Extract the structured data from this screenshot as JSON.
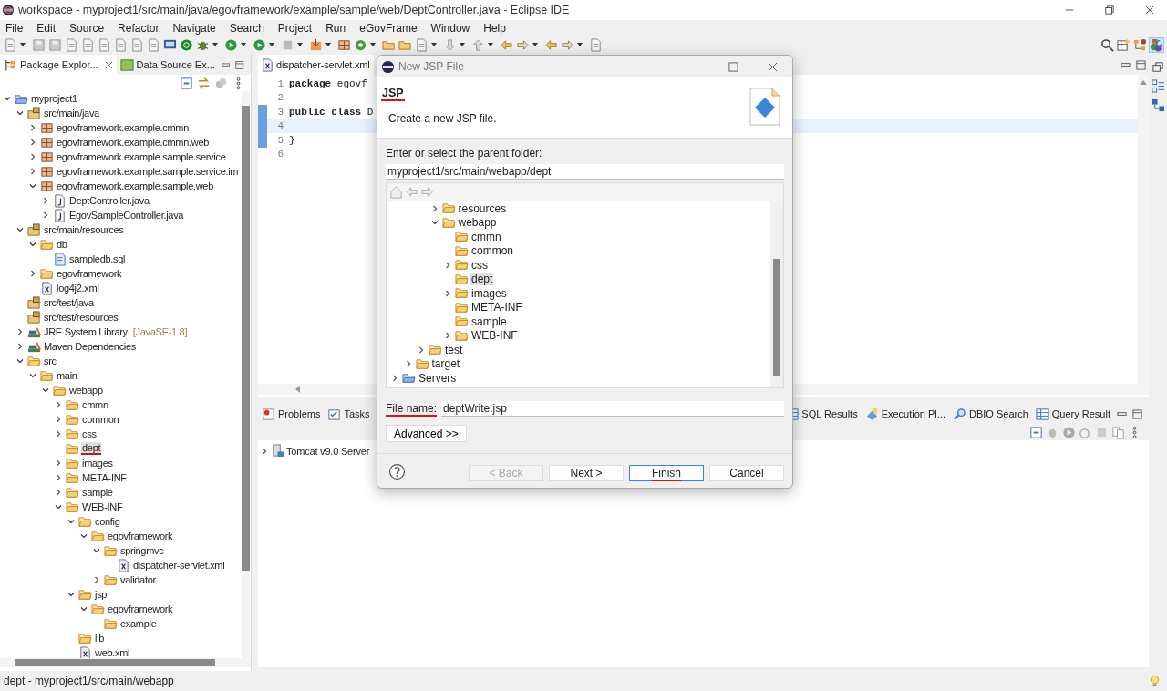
{
  "window": {
    "title": "workspace - myproject1/src/main/java/egovframework/example/sample/web/DeptController.java - Eclipse IDE"
  },
  "menu": [
    "File",
    "Edit",
    "Source",
    "Refactor",
    "Navigate",
    "Search",
    "Project",
    "Run",
    "eGovFrame",
    "Window",
    "Help"
  ],
  "left_panel": {
    "tabs": [
      {
        "label": "Package Explor...",
        "selected": true
      },
      {
        "label": "Data Source Ex...",
        "selected": false
      }
    ],
    "tree": [
      {
        "label": "myproject1",
        "kind": "project",
        "expanded": true,
        "selected": false,
        "children": [
          {
            "label": "src/main/java",
            "kind": "source-folder",
            "expanded": true,
            "selected": false,
            "children": [
              {
                "label": "egovframework.example.cmmn",
                "kind": "package",
                "expanded": false,
                "selected": false
              },
              {
                "label": "egovframework.example.cmmn.web",
                "kind": "package",
                "expanded": false,
                "selected": false
              },
              {
                "label": "egovframework.example.sample.service",
                "kind": "package",
                "expanded": false,
                "selected": false
              },
              {
                "label": "egovframework.example.sample.service.im",
                "kind": "package",
                "expanded": false,
                "selected": false
              },
              {
                "label": "egovframework.example.sample.web",
                "kind": "package",
                "expanded": true,
                "selected": false,
                "children": [
                  {
                    "label": "DeptController.java",
                    "kind": "java-file",
                    "expanded": false,
                    "selected": false
                  },
                  {
                    "label": "EgovSampleController.java",
                    "kind": "java-file",
                    "expanded": false,
                    "selected": false
                  }
                ]
              }
            ]
          },
          {
            "label": "src/main/resources",
            "kind": "source-folder",
            "expanded": true,
            "selected": false,
            "children": [
              {
                "label": "db",
                "kind": "folder",
                "expanded": true,
                "selected": false,
                "children": [
                  {
                    "label": "sampledb.sql",
                    "kind": "sql-file",
                    "selected": false
                  }
                ]
              },
              {
                "label": "egovframework",
                "kind": "folder",
                "expanded": false,
                "selected": false
              },
              {
                "label": "log4j2.xml",
                "kind": "xml-file",
                "selected": false
              }
            ]
          },
          {
            "label": "src/test/java",
            "kind": "source-folder",
            "selected": false
          },
          {
            "label": "src/test/resources",
            "kind": "source-folder",
            "selected": false
          },
          {
            "label": "JRE System Library",
            "suffix": "[JavaSE-1.8]",
            "kind": "library",
            "expanded": false,
            "selected": false
          },
          {
            "label": "Maven Dependencies",
            "kind": "library",
            "expanded": false,
            "selected": false
          },
          {
            "label": "src",
            "kind": "folder",
            "expanded": true,
            "selected": false,
            "children": [
              {
                "label": "main",
                "kind": "folder",
                "expanded": true,
                "selected": false,
                "children": [
                  {
                    "label": "webapp",
                    "kind": "folder",
                    "expanded": true,
                    "selected": false,
                    "children": [
                      {
                        "label": "cmmn",
                        "kind": "folder",
                        "expanded": false,
                        "selected": false
                      },
                      {
                        "label": "common",
                        "kind": "folder",
                        "expanded": false,
                        "selected": false
                      },
                      {
                        "label": "css",
                        "kind": "folder",
                        "expanded": false,
                        "selected": false
                      },
                      {
                        "label": "dept",
                        "kind": "folder",
                        "selected": true,
                        "underlined": true
                      },
                      {
                        "label": "images",
                        "kind": "folder",
                        "expanded": false,
                        "selected": false
                      },
                      {
                        "label": "META-INF",
                        "kind": "folder",
                        "expanded": false,
                        "selected": false
                      },
                      {
                        "label": "sample",
                        "kind": "folder",
                        "expanded": false,
                        "selected": false
                      },
                      {
                        "label": "WEB-INF",
                        "kind": "folder",
                        "expanded": true,
                        "selected": false,
                        "children": [
                          {
                            "label": "config",
                            "kind": "folder",
                            "expanded": true,
                            "selected": false,
                            "children": [
                              {
                                "label": "egovframework",
                                "kind": "folder",
                                "expanded": true,
                                "selected": false,
                                "children": [
                                  {
                                    "label": "springmvc",
                                    "kind": "folder",
                                    "expanded": true,
                                    "selected": false,
                                    "children": [
                                      {
                                        "label": "dispatcher-servlet.xml",
                                        "kind": "xml-file",
                                        "selected": false
                                      }
                                    ]
                                  },
                                  {
                                    "label": "validator",
                                    "kind": "folder",
                                    "expanded": false,
                                    "selected": false
                                  }
                                ]
                              }
                            ]
                          },
                          {
                            "label": "jsp",
                            "kind": "folder",
                            "expanded": true,
                            "selected": false,
                            "children": [
                              {
                                "label": "egovframework",
                                "kind": "folder",
                                "expanded": true,
                                "selected": false,
                                "children": [
                                  {
                                    "label": "example",
                                    "kind": "folder",
                                    "selected": false
                                  }
                                ]
                              }
                            ]
                          },
                          {
                            "label": "lib",
                            "kind": "folder",
                            "selected": false
                          },
                          {
                            "label": "web.xml",
                            "kind": "xml-file",
                            "selected": false
                          }
                        ]
                      }
                    ]
                  }
                ]
              }
            ]
          }
        ]
      }
    ]
  },
  "editor": {
    "tab": {
      "label": "dispatcher-servlet.xml"
    },
    "lines": [
      {
        "number": "1",
        "text": "**package** egovf",
        "current": false,
        "changed": false
      },
      {
        "number": "2",
        "current": false,
        "changed": false
      },
      {
        "number": "3",
        "text": "**public** **class** D",
        "current": false,
        "changed": true
      },
      {
        "number": "4",
        "current": true,
        "changed": true
      },
      {
        "number": "5",
        "text": "}",
        "current": false,
        "changed": true
      },
      {
        "number": "6",
        "current": false,
        "changed": false
      }
    ]
  },
  "bottom_panel": {
    "tabs": [
      {
        "label": "Problems",
        "kind": "problems"
      },
      {
        "label": "Tasks",
        "kind": "tasks"
      },
      {
        "label": "SQL Results",
        "kind": "table"
      },
      {
        "label": "Execution Pl...",
        "kind": "plan"
      },
      {
        "label": "DBIO Search",
        "kind": "search"
      },
      {
        "label": "Query Result",
        "kind": "table"
      }
    ],
    "rows": [
      {
        "label": "Tomcat v9.0 Server",
        "expanded": false
      }
    ]
  },
  "dialog": {
    "title": "New JSP File",
    "heading": "JSP",
    "heading_underlined": true,
    "description": "Create a new JSP file.",
    "folder_label": "Enter or select the parent folder:",
    "folder_value": "myproject1/src/main/webapp/dept",
    "folder_tree": [
      {
        "children": [
          {
            "children": [
              {
                "children": [
                  {
                    "label": "resources",
                    "kind": "folder",
                    "expanded": false,
                    "selected": false
                  },
                  {
                    "label": "webapp",
                    "kind": "folder",
                    "expanded": true,
                    "selected": false,
                    "children": [
                      {
                        "label": "cmmn",
                        "kind": "folder",
                        "selected": false
                      },
                      {
                        "label": "common",
                        "kind": "folder",
                        "selected": false
                      },
                      {
                        "label": "css",
                        "kind": "folder",
                        "expanded": false,
                        "selected": false
                      },
                      {
                        "label": "dept",
                        "kind": "folder",
                        "selected": true
                      },
                      {
                        "label": "images",
                        "kind": "folder",
                        "expanded": false,
                        "selected": false
                      },
                      {
                        "label": "META-INF",
                        "kind": "folder",
                        "selected": false
                      },
                      {
                        "label": "sample",
                        "kind": "folder",
                        "selected": false
                      },
                      {
                        "label": "WEB-INF",
                        "kind": "folder",
                        "expanded": false,
                        "selected": false
                      }
                    ]
                  }
                ]
              },
              {
                "label": "test",
                "kind": "folder",
                "expanded": false,
                "selected": false
              }
            ]
          },
          {
            "label": "target",
            "kind": "folder",
            "expanded": false,
            "selected": false
          }
        ]
      },
      {
        "label": "Servers",
        "kind": "project",
        "expanded": false,
        "selected": false
      }
    ],
    "file_name_label": "File name:",
    "file_name_underlined": true,
    "file_name_value": "deptWrite.jsp",
    "advanced_button": "Advanced >>",
    "buttons": [
      {
        "label": "< Back",
        "disabled": true,
        "default": false,
        "underlined": false
      },
      {
        "label": "Next >",
        "disabled": false,
        "default": false,
        "underlined": false
      },
      {
        "label": "Finish",
        "disabled": false,
        "default": true,
        "underlined": true
      },
      {
        "label": "Cancel",
        "disabled": false,
        "default": false,
        "underlined": false
      }
    ]
  },
  "status_bar": {
    "text": "dept - myproject1/src/main/webapp"
  }
}
